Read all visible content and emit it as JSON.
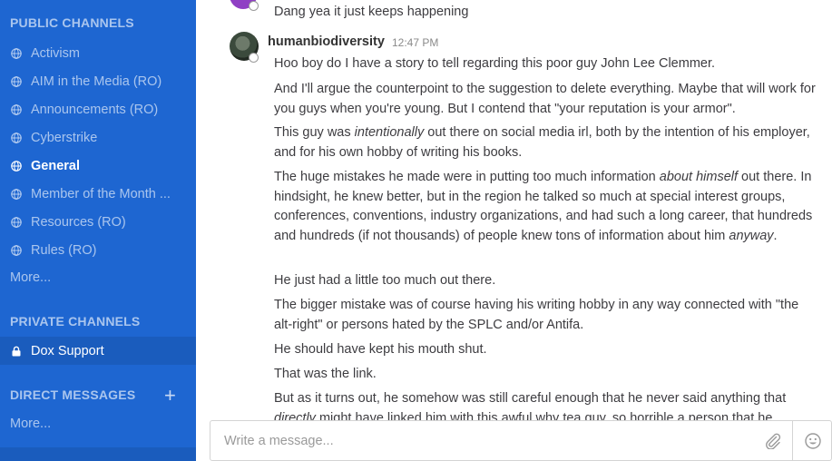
{
  "sidebar": {
    "public_header": "PUBLIC CHANNELS",
    "public_channels": [
      {
        "label": "Activism"
      },
      {
        "label": "AIM in the Media (RO)"
      },
      {
        "label": "Announcements (RO)"
      },
      {
        "label": "Cyberstrike"
      },
      {
        "label": "General"
      },
      {
        "label": "Member of the Month ..."
      },
      {
        "label": "Resources (RO)"
      },
      {
        "label": "Rules (RO)"
      }
    ],
    "public_more": "More...",
    "private_header": "PRIVATE CHANNELS",
    "private_channels": [
      {
        "label": "Dox Support"
      }
    ],
    "direct_header": "DIRECT MESSAGES",
    "direct_add": "+",
    "direct_more": "More...",
    "accent_color": "#1e66d1"
  },
  "main": {
    "previous_message": "Dang yea it just keeps happening",
    "post": {
      "username": "humanbiodiversity",
      "time": "12:47 PM",
      "p1": "Hoo boy do I have a story to tell regarding this poor guy John Lee Clemmer.",
      "p2": "And I'll argue the counterpoint to the suggestion to delete everything. Maybe that will work for you guys when you're young. But I contend that \"your reputation is your armor\".",
      "p3_a": "This guy was ",
      "p3_em": "intentionally",
      "p3_b": " out there on social media irl, both by the intention of his employer, and for his own hobby of writing his books.",
      "p4_a": "The huge mistakes he made were in putting too much information ",
      "p4_em": "about himself",
      "p4_b": " out there. In hindsight, he knew better, but in the region he talked so much at special interest groups, conferences, conventions, industry organizations, and had such a long career, that hundreds and hundreds (if not thousands) of people knew tons of information about him ",
      "p4_em2": "anyway",
      "p4_c": ".",
      "p5": "He just had a little too much out there.",
      "p6": "The bigger mistake was of course having his writing hobby in any way connected with \"the alt-right\" or persons hated by the SPLC and/or Antifa.",
      "p7": "He should have kept his mouth shut.",
      "p8": "That was the link.",
      "p9_a": "But as it turns out, he somehow was still careful enough that he never said anything that ",
      "p9_em": "directly",
      "p9_b": " might have linked him with this awful why tea guy, so horrible a person that he"
    },
    "composer": {
      "placeholder": "Write a message...",
      "attach_icon": "paperclip-icon",
      "emoji_icon": "smiley-icon"
    }
  }
}
